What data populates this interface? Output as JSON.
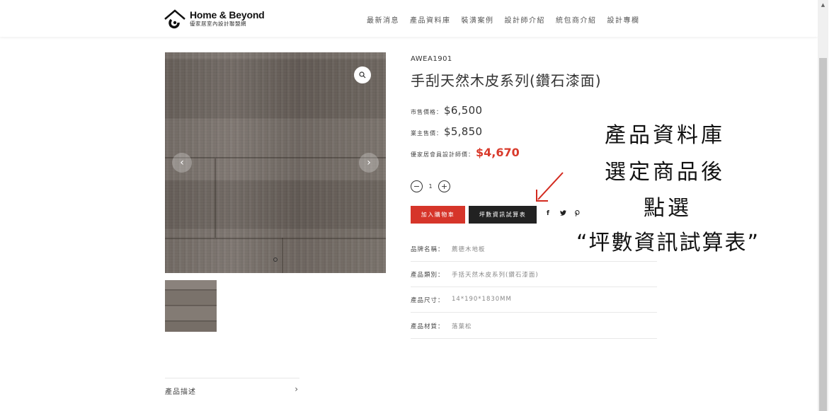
{
  "header": {
    "logo_title": "Home & Beyond",
    "logo_subtitle": "優家居室內設計聯盟網",
    "nav": [
      "最新消息",
      "產品資料庫",
      "裝潢案例",
      "設計師介紹",
      "統包商介紹",
      "設計專欄"
    ]
  },
  "product": {
    "sku": "AWEA1901",
    "title": "手刮天然木皮系列(鑽石漆面)",
    "prices": {
      "market_label": "市售價格：",
      "market_value": "$6,500",
      "owner_label": "業主售價：",
      "owner_value": "$5,850",
      "member_label": "優家居會員設計師價：",
      "member_value": "$4,670"
    },
    "quantity": "1",
    "qty_minus": "−",
    "qty_plus": "+",
    "add_to_cart": "加入購物車",
    "calculator": "坪數資訊試算表",
    "share": {
      "facebook": "f",
      "twitter": "🐦",
      "pinterest": "℗"
    },
    "specs": [
      {
        "label": "品牌名稱：",
        "value": "薦德木地板"
      },
      {
        "label": "產品類別：",
        "value": "手括天然木皮系列(鑽石漆面)"
      },
      {
        "label": "產品尺寸：",
        "value": "14*190*1830MM"
      },
      {
        "label": "產品材質：",
        "value": "落葉松"
      }
    ],
    "description_tab": "產品描述",
    "description_arrow": "›"
  },
  "gallery": {
    "zoom_icon": "search-icon",
    "prev": "‹",
    "next": "›"
  },
  "annotation": {
    "lines": [
      "產品資料庫",
      "選定商品後",
      "點選",
      "“坪數資訊試算表”"
    ],
    "arrow_color": "#d32a1f"
  },
  "colors": {
    "accent_red": "#d6352a",
    "dark_button": "#222222",
    "member_price": "#d93a2b"
  }
}
